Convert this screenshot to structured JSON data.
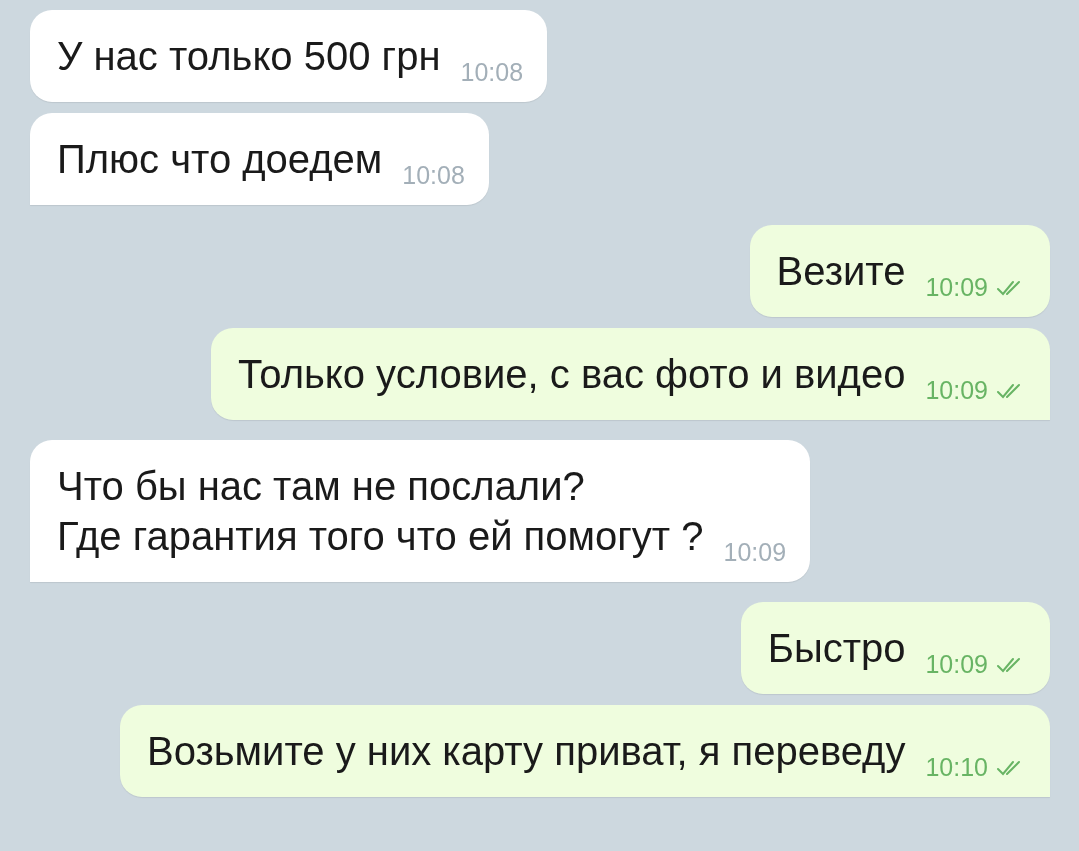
{
  "messages": [
    {
      "kind": "incoming",
      "text": "У нас только 500 грн",
      "time": "10:08"
    },
    {
      "kind": "incoming",
      "text": "Плюс что доедем",
      "time": "10:08"
    },
    {
      "kind": "outgoing",
      "text": "Везите",
      "time": "10:09",
      "read": true
    },
    {
      "kind": "outgoing",
      "text": "Только условие, с вас фото и видео",
      "time": "10:09",
      "read": true
    },
    {
      "kind": "incoming",
      "text": "Что бы нас там не послали?\nГде гарантия того что ей помогут ?",
      "time": "10:09"
    },
    {
      "kind": "outgoing",
      "text": "Быстро",
      "time": "10:09",
      "read": true
    },
    {
      "kind": "outgoing",
      "text": "Возьмите у них карту приват, я переведу",
      "time": "10:10",
      "read": true
    }
  ]
}
